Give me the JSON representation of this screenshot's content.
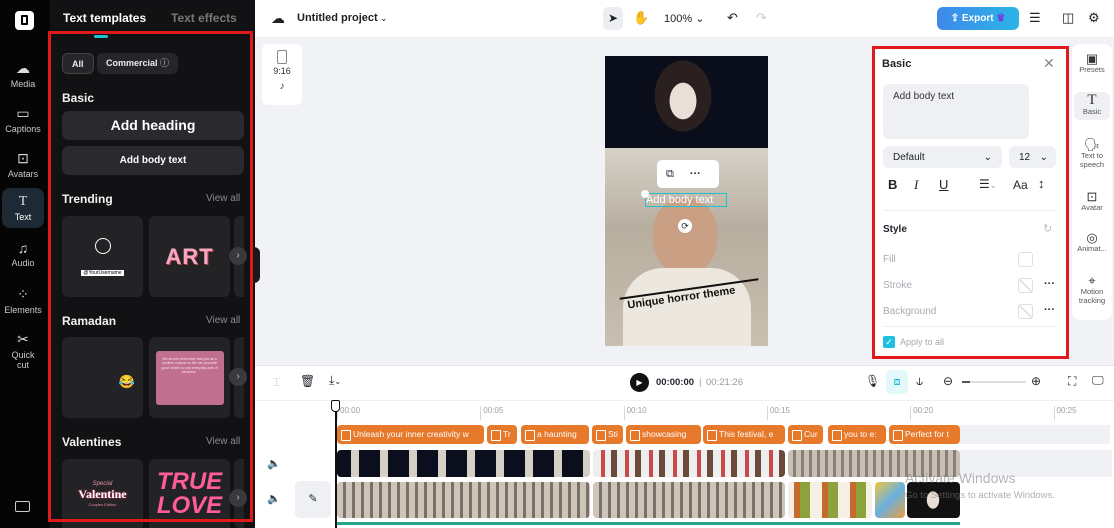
{
  "rail": {
    "items": [
      {
        "label": "Media",
        "icon": "cloud-upload-icon"
      },
      {
        "label": "Captions",
        "icon": "captions-icon"
      },
      {
        "label": "Avatars",
        "icon": "avatar-icon"
      },
      {
        "label": "Text",
        "icon": "text-icon",
        "active": true
      },
      {
        "label": "Audio",
        "icon": "music-icon"
      },
      {
        "label": "Elements",
        "icon": "elements-icon"
      },
      {
        "label": "Quick",
        "label2": "cut",
        "icon": "quick-cut-icon"
      }
    ],
    "keyboard_icon": "keyboard-icon"
  },
  "panel": {
    "tabs": [
      "Text templates",
      "Text effects"
    ],
    "filters": [
      "All",
      "Commercial"
    ],
    "basic": {
      "title": "Basic",
      "add_heading": "Add heading",
      "add_body": "Add body text"
    },
    "sections": [
      {
        "title": "Trending",
        "view_all": "View all",
        "cards": [
          "Follow Me",
          "@YourUsername",
          "ART"
        ]
      },
      {
        "title": "Ramadan",
        "view_all": "View all",
        "cards": [
          "It's a",
          "PRANK 😂",
          "We should remember that just as a positive outlook on life can promote good health so can everyday acts of kindness."
        ]
      },
      {
        "title": "Valentines",
        "view_all": "View all",
        "cards": [
          "Special",
          "Valentine",
          "Couples Edition",
          "TRUE",
          "LOVE"
        ]
      }
    ]
  },
  "topbar": {
    "project": "Untitled project",
    "zoom": "100%",
    "export": "Export"
  },
  "aspect": {
    "ratio": "9:16"
  },
  "preview": {
    "overlay_text": "Add body text",
    "caption": "Unique horror theme"
  },
  "props": {
    "title": "Basic",
    "text": "Add body text",
    "font": "Default",
    "size": "12",
    "style_title": "Style",
    "fill": "Fill",
    "stroke": "Stroke",
    "background": "Background",
    "apply_all": "Apply to all",
    "apply_checked": true,
    "accent": "#20c0e0"
  },
  "rrail": [
    {
      "label": "Presets"
    },
    {
      "label": "Basic"
    },
    {
      "label": "Text to speech"
    },
    {
      "label": "Avatar"
    },
    {
      "label": "Animat..."
    },
    {
      "label": "Motion tracking"
    }
  ],
  "timeline": {
    "current": "00:00:00",
    "total": "00:21:26",
    "ticks": [
      "00:00",
      "00:05",
      "00:10",
      "00:15",
      "00:20",
      "00:25"
    ],
    "captions": [
      "Unleash your inner creativity w",
      "Tr",
      "a haunting",
      "Sti",
      "showcasing",
      "This festival, e",
      "Cur",
      "you to e:",
      "Perfect for t"
    ]
  },
  "watermark": {
    "line1": "Activate Windows",
    "line2": "Go to Settings to activate Windows."
  }
}
